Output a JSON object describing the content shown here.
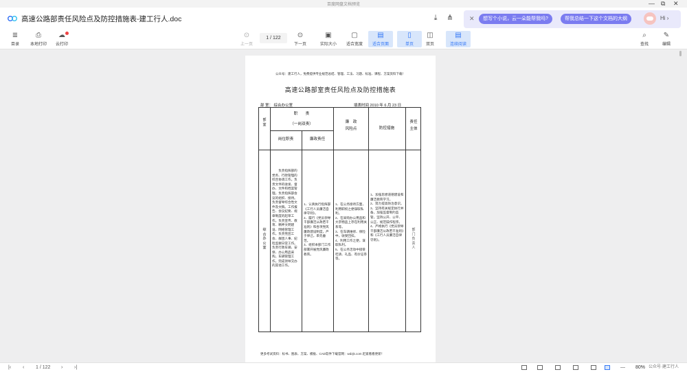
{
  "window": {
    "title": "百度网盘文档预览",
    "controls": [
      "—",
      "⧉",
      "✕"
    ]
  },
  "header": {
    "doc_title": "高速公路部责任风险点及防控措施表-建工行人.doc",
    "ai_bar": {
      "chip1": "想写个小说，云一朵能帮我吗?",
      "chip2": "帮我总结一下这个文档的大纲",
      "greeting": "Hi ›"
    }
  },
  "toolbar": {
    "items": [
      {
        "label": "目录",
        "icon": "≣"
      },
      {
        "label": "本地打印",
        "icon": "⎙"
      },
      {
        "label": "云打印",
        "icon": "☁"
      },
      {
        "label": "上一页",
        "icon": "⊙"
      },
      {
        "label": "下一页",
        "icon": "⊙"
      },
      {
        "label": "实际大小",
        "icon": "▣"
      },
      {
        "label": "适合宽度",
        "icon": "▢"
      },
      {
        "label": "适合页面",
        "icon": "▤"
      },
      {
        "label": "单页",
        "icon": "▯"
      },
      {
        "label": "双页",
        "icon": "◫"
      },
      {
        "label": "连续阅读",
        "icon": "▤"
      },
      {
        "label": "查找",
        "icon": "⌕"
      },
      {
        "label": "编辑",
        "icon": "✎"
      }
    ],
    "page_indicator": "1  / 122"
  },
  "document": {
    "notice": "公众号：建工行人，免费提供专业规范总结、管理、工法、习题、标准、课程、方案资料下载！",
    "title": "高速公路部室责任风险点及防控措施表",
    "dept_label": "部  室：  综合办公室",
    "date_label": "填表时间  2010 年 6 月 23 日",
    "headers": {
      "dept": "部室",
      "duty": "职　　责",
      "duty_sub": "（一岗双责）",
      "post_duty": "岗位职责",
      "clean_duty": "廉政责任",
      "risk": "廉　政\n风险点",
      "measures": "防控措施",
      "subject": "责任主体"
    },
    "row": {
      "dept": "综合办公室",
      "post_duty": "　　负责指挥部的党务、行政管理的综合协调工作。负责文件的收发、督办、文件和档案管理。负责指挥部会议的组织、接待。负责督导综合性文件及文稿。工作报告、会议纪要、规章制度的起草工作。负责宣传、教育、精神文明建设、网络管理工作。负责党团工会、群团人事、纪检监察日常工作。负责行政车辆、安保、办公用品采购。车辆管理工作。完成领导交办的其他工作。",
      "clean_duty": "1、认真执行指挥部《工行人员廉洁自律守则》。\n2、履行《党员领导干部廉洁从政若干准则》和各项党风廉政建设制度，严于律己，率先垂范。\n3、组织本部门工作部署开展党风廉政教育。",
      "risk": "1、在公务接待方面，利用职权之便谋取私利。\n2、在采购办公用品和大宗物品上存在利用关系等。\n3、在车辆维修、保险中，收受回扣。\n4、利用工作之便，谋取私利。\n5、在公务活动中接受吃请、礼品、有价证券等。",
      "measures": "1、加强思想道德建设和廉洁教育学习。\n2、努力提高防治意识。\n3、坚持有关规定执行并备，加强监督制约监管，坚持公开、公平、公正、规范操作程序。\n4、严格执行《党员领导干部廉洁从政若干准则》和《工行人员廉洁自律守则》。",
      "subject": "部门负责人"
    },
    "footer": "更多考试资料：标书、图表、方案、模板、CAD软件下载官网：wdzjk.com  赶紧看看更新！"
  },
  "statusbar": {
    "page": "1  / 122",
    "zoom": "80%",
    "watermark": "公众号·建工行人"
  }
}
